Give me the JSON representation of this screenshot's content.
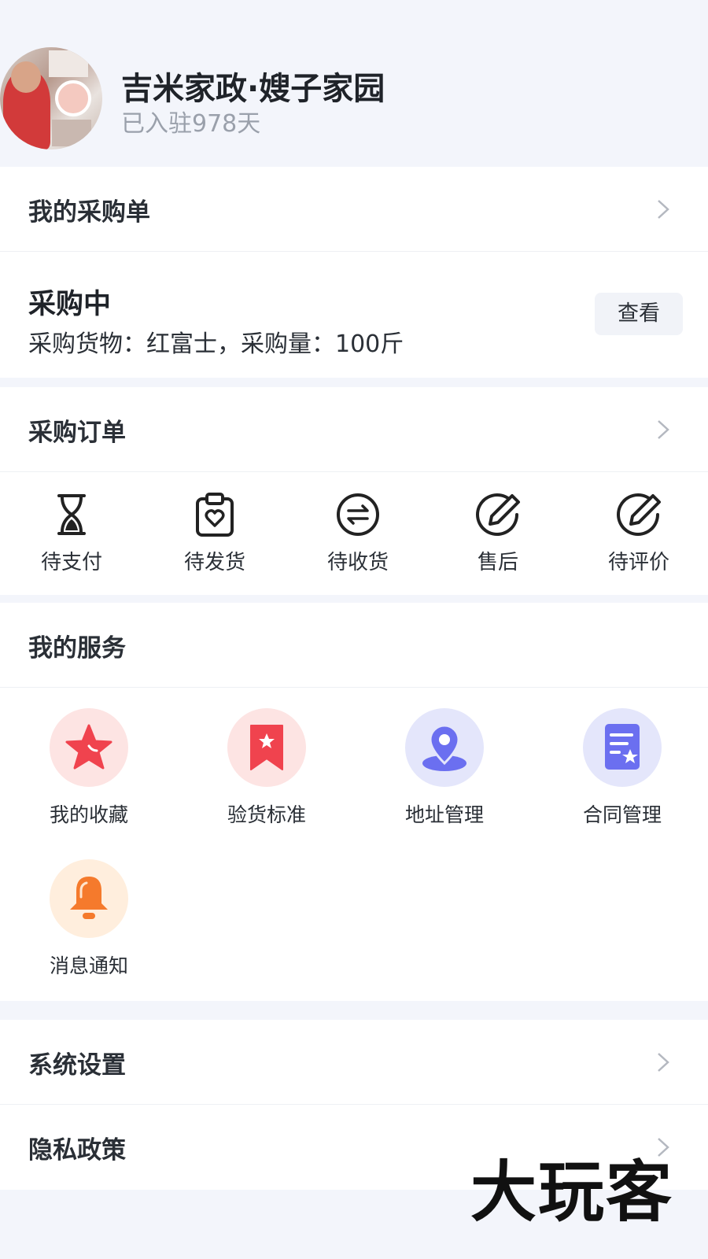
{
  "profile": {
    "name": "吉米家政·嫂子家园",
    "days": "已入驻978天"
  },
  "purchase_list": {
    "title": "我的采购单"
  },
  "purchase_status": {
    "title": "采购中",
    "description": "采购货物：红富士，采购量：100斤",
    "view_button": "查看"
  },
  "orders": {
    "title": "采购订单",
    "items": [
      {
        "label": "待支付",
        "icon": "hourglass-icon"
      },
      {
        "label": "待发货",
        "icon": "clipboard-heart-icon"
      },
      {
        "label": "待收货",
        "icon": "exchange-arrows-icon"
      },
      {
        "label": "售后",
        "icon": "edit-pencil-icon"
      },
      {
        "label": "待评价",
        "icon": "edit-pencil-icon"
      }
    ]
  },
  "services": {
    "title": "我的服务",
    "items": [
      {
        "label": "我的收藏",
        "icon": "star-icon",
        "color": "#f0434e",
        "bg": "#fde4e3"
      },
      {
        "label": "验货标准",
        "icon": "bookmark-star-icon",
        "color": "#f0434e",
        "bg": "#fde4e3"
      },
      {
        "label": "地址管理",
        "icon": "location-pin-icon",
        "color": "#6b6ff0",
        "bg": "#e4e6fb"
      },
      {
        "label": "合同管理",
        "icon": "contract-star-icon",
        "color": "#6b6ff0",
        "bg": "#e4e6fb"
      },
      {
        "label": "消息通知",
        "icon": "bell-icon",
        "color": "#f57a2c",
        "bg": "#ffeedd"
      }
    ]
  },
  "settings": {
    "title": "系统设置"
  },
  "privacy": {
    "title": "隐私政策"
  },
  "watermark": "大玩客"
}
